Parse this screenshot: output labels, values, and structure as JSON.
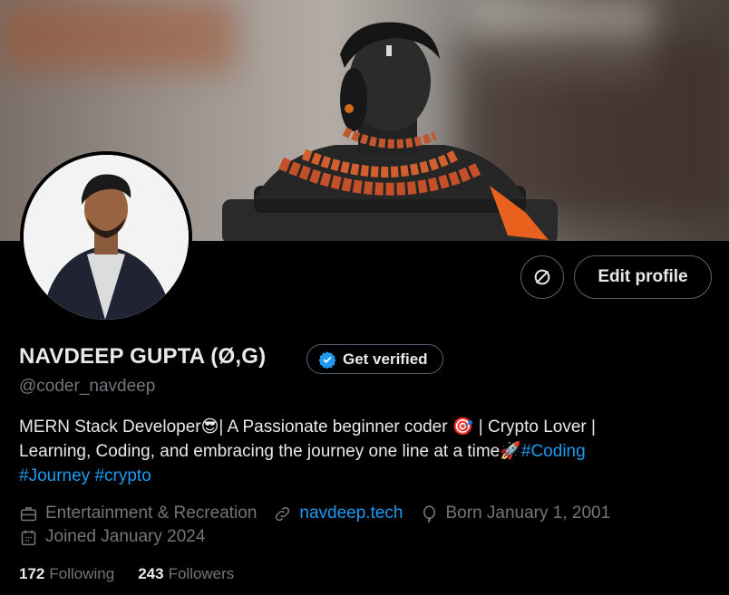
{
  "profile": {
    "name": "NAVDEEP GUPTA (Ø,G)",
    "handle": "@coder_navdeep",
    "get_verified_label": "Get verified",
    "edit_profile_label": "Edit profile",
    "bio": {
      "line1_text": "MERN Stack Developer😎| A Passionate beginner coder 🎯 | Crypto Lover |",
      "line2_text": "Learning, Coding, and embracing the journey one line at a time🚀",
      "line2_tag": "#Coding",
      "line3_tag1": "#Journey",
      "line3_tag2": "#crypto"
    },
    "category": "Entertainment & Recreation",
    "website": "navdeep.tech",
    "born": "Born January 1, 2001",
    "joined": "Joined January 2024",
    "following_count": "172",
    "following_label": "Following",
    "followers_count": "243",
    "followers_label": "Followers"
  },
  "colors": {
    "background": "#000000",
    "text_primary": "#e7e9ea",
    "text_secondary": "#71767b",
    "accent": "#1d9bf0",
    "border": "#536471"
  },
  "icons": [
    "refresh-x-icon",
    "verified-badge-icon",
    "briefcase-icon",
    "link-icon",
    "balloon-icon",
    "calendar-icon"
  ]
}
